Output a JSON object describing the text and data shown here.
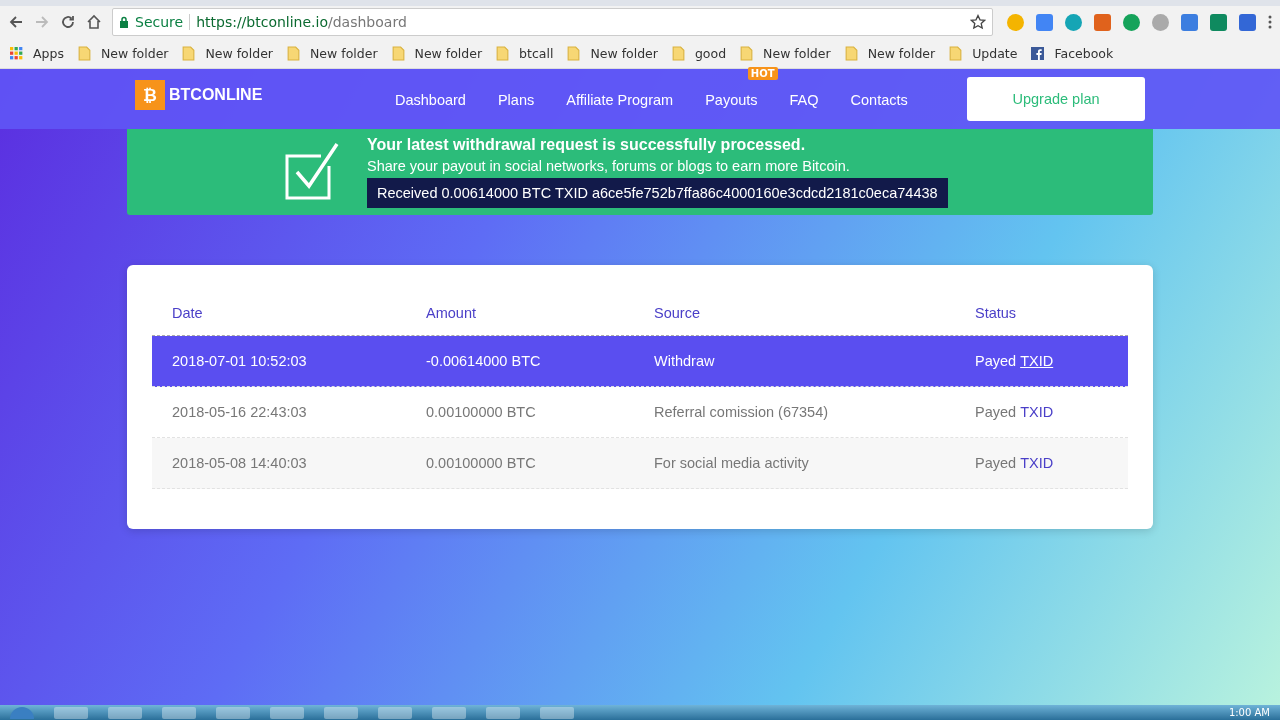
{
  "browser": {
    "secure_label": "Secure",
    "url_host": "https://btconline.io",
    "url_path": "/dashboard",
    "bookmarks": [
      {
        "kind": "apps",
        "label": "Apps"
      },
      {
        "kind": "folder",
        "label": "New folder"
      },
      {
        "kind": "folder",
        "label": "New folder"
      },
      {
        "kind": "folder",
        "label": "New folder"
      },
      {
        "kind": "folder",
        "label": "New folder"
      },
      {
        "kind": "folder",
        "label": "btcall"
      },
      {
        "kind": "folder",
        "label": "New folder"
      },
      {
        "kind": "folder",
        "label": "good"
      },
      {
        "kind": "folder",
        "label": "New folder"
      },
      {
        "kind": "folder",
        "label": "New folder"
      },
      {
        "kind": "folder",
        "label": "Update"
      },
      {
        "kind": "facebook",
        "label": "Facebook"
      }
    ]
  },
  "header": {
    "logo": "BTCONLINE",
    "logo_mark": "₿",
    "nav": [
      {
        "label": "Dashboard"
      },
      {
        "label": "Plans"
      },
      {
        "label": "Affiliate Program"
      },
      {
        "label": "Payouts",
        "badge": "HOT"
      },
      {
        "label": "FAQ"
      },
      {
        "label": "Contacts"
      }
    ],
    "cta": "Upgrade plan"
  },
  "banner": {
    "title": "Your latest withdrawal request is successfully processed.",
    "text": "Share your payout in social networks, forums or blogs to earn more Bitcoin.",
    "receipt": "Received 0.00614000 BTC TXID a6ce5fe752b7ffa86c4000160e3cdcd2181c0eca74438"
  },
  "table": {
    "columns": [
      "Date",
      "Amount",
      "Source",
      "Status"
    ],
    "rows": [
      {
        "date": "2018-07-01 10:52:03",
        "amount": "-0.00614000 BTC",
        "source": "Withdraw",
        "status": "Payed",
        "link": "TXID",
        "selected": true
      },
      {
        "date": "2018-05-16 22:43:03",
        "amount": "0.00100000 BTC",
        "source": "Referral comission (67354)",
        "status": "Payed",
        "link": "TXID",
        "selected": false
      },
      {
        "date": "2018-05-08 14:40:03",
        "amount": "0.00100000 BTC",
        "source": "For social media activity",
        "status": "Payed",
        "link": "TXID",
        "selected": false
      }
    ]
  },
  "taskbar": {
    "clock": "1:00 AM"
  }
}
